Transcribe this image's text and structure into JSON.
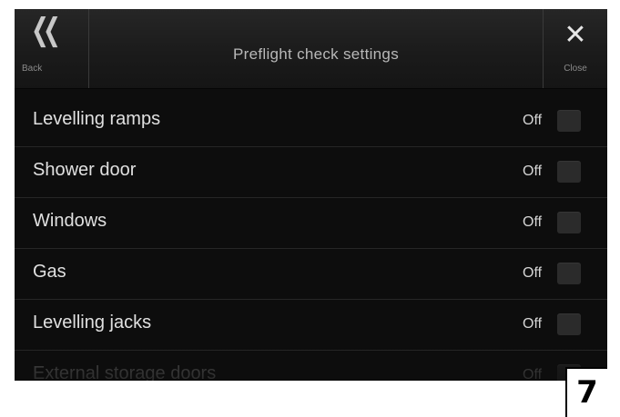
{
  "header": {
    "title": "Preflight check settings",
    "back_label": "Back",
    "back_icon": "double-chevron-left-icon",
    "close_label": "Close",
    "close_icon": "close-x-icon"
  },
  "rows": [
    {
      "label": "Levelling ramps",
      "state": "Off"
    },
    {
      "label": "Shower door",
      "state": "Off"
    },
    {
      "label": "Windows",
      "state": "Off"
    },
    {
      "label": "Gas",
      "state": "Off"
    },
    {
      "label": "Levelling jacks",
      "state": "Off"
    },
    {
      "label": "External storage doors",
      "state": "Off"
    }
  ],
  "page_number": "7",
  "colors": {
    "background": "#0d0d0d",
    "text": "#e0e0e0",
    "toggle_off": "#2b2b2b"
  }
}
